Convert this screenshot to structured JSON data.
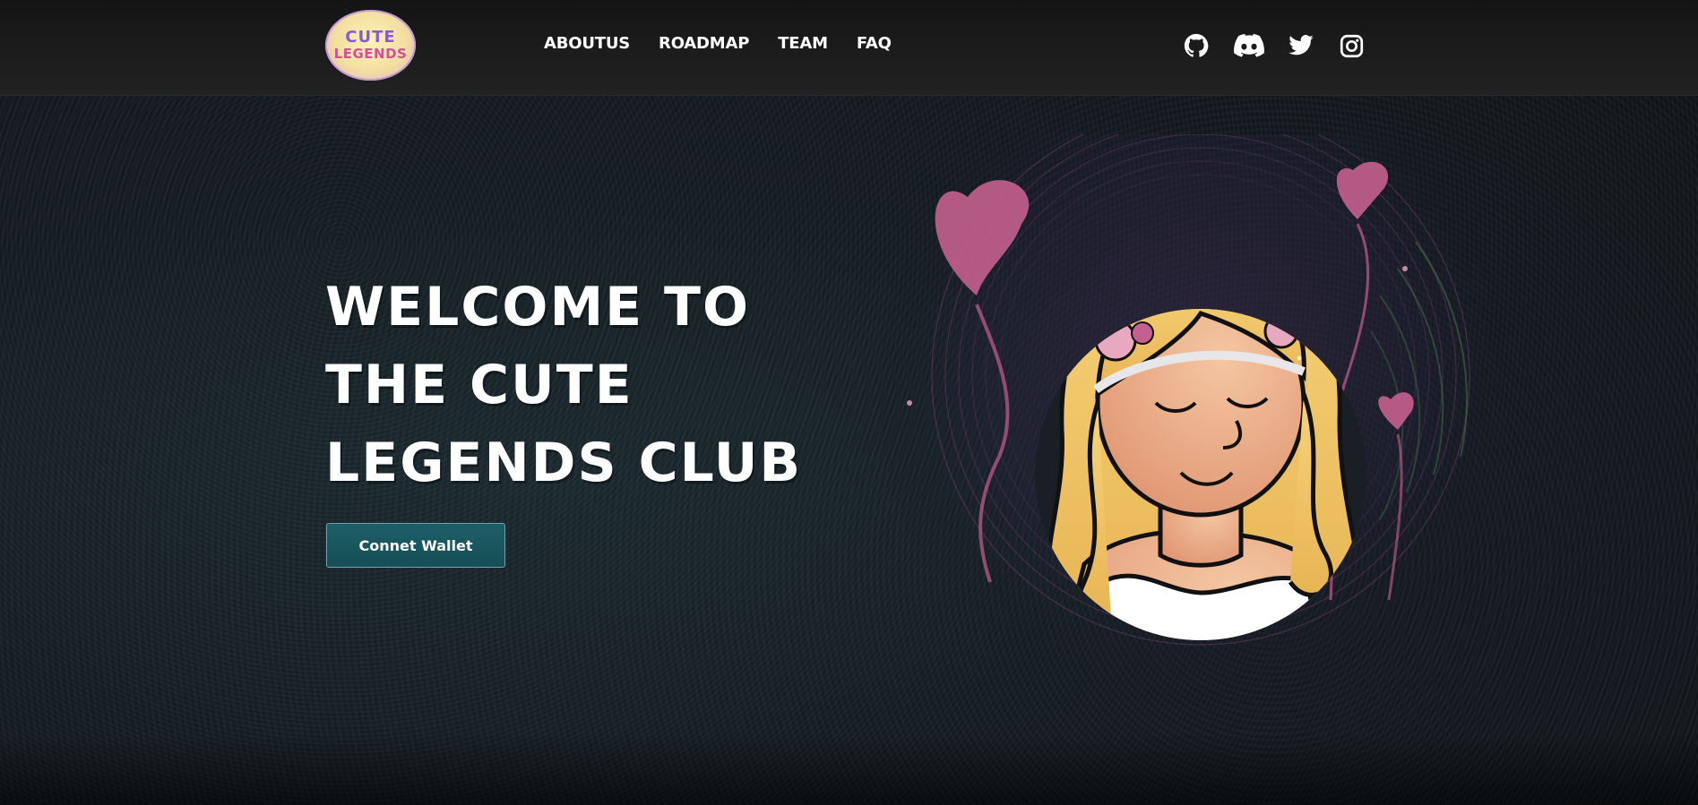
{
  "brand": {
    "logo_line1": "CUTE",
    "logo_line2": "LEGENDS"
  },
  "nav": {
    "items": [
      "ABOUTUS",
      "ROADMAP",
      "TEAM",
      "FAQ"
    ]
  },
  "social": [
    "github-icon",
    "discord-icon",
    "twitter-icon",
    "instagram-icon"
  ],
  "hero": {
    "title_lines": [
      "WELCOME TO",
      "THE CUTE",
      "LEGENDS CLUB"
    ],
    "cta_label": "Connet Wallet"
  },
  "colors": {
    "button_bg": "#1b5a62",
    "button_border": "#6fa4aa",
    "nav_bg": "#1a1a1a",
    "heart": "#c4608e",
    "hair": "#f2c866",
    "skin": "#e9a27c"
  }
}
